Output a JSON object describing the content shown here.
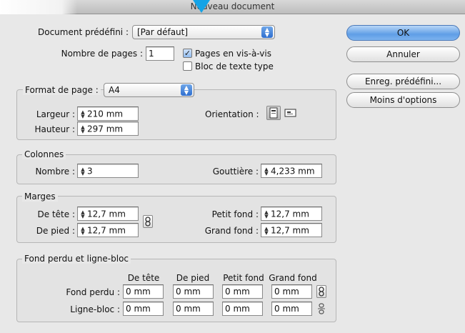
{
  "window": {
    "title": "Nouveau document"
  },
  "preset": {
    "label": "Document prédéfini :",
    "value": "[Par défaut]"
  },
  "pages": {
    "label": "Nombre de pages :",
    "value": "1",
    "facing_label": "Pages en vis-à-vis",
    "facing_checked": true,
    "master_text_label": "Bloc de texte type",
    "master_text_checked": false
  },
  "page_format": {
    "group_label": "Format de page :",
    "value": "A4",
    "width_label": "Largeur :",
    "width": "210 mm",
    "height_label": "Hauteur :",
    "height": "297 mm",
    "orientation_label": "Orientation :"
  },
  "columns": {
    "group_label": "Colonnes",
    "number_label": "Nombre :",
    "number": "3",
    "gutter_label": "Gouttière :",
    "gutter": "4,233 mm"
  },
  "margins": {
    "group_label": "Marges",
    "top_label": "De tête :",
    "top": "12,7 mm",
    "bottom_label": "De pied :",
    "bottom": "12,7 mm",
    "inside_label": "Petit fond :",
    "inside": "12,7 mm",
    "outside_label": "Grand fond :",
    "outside": "12,7 mm"
  },
  "bleed_slug": {
    "group_label": "Fond perdu et ligne-bloc",
    "headers": [
      "De tête",
      "De pied",
      "Petit fond",
      "Grand fond"
    ],
    "bleed_label": "Fond perdu :",
    "bleed": [
      "0 mm",
      "0 mm",
      "0 mm",
      "0 mm"
    ],
    "slug_label": "Ligne-bloc :",
    "slug": [
      "0 mm",
      "0 mm",
      "0 mm",
      "0 mm"
    ]
  },
  "buttons": {
    "ok": "OK",
    "cancel": "Annuler",
    "save_preset": "Enreg. prédéfini...",
    "fewer_options": "Moins d'options"
  }
}
